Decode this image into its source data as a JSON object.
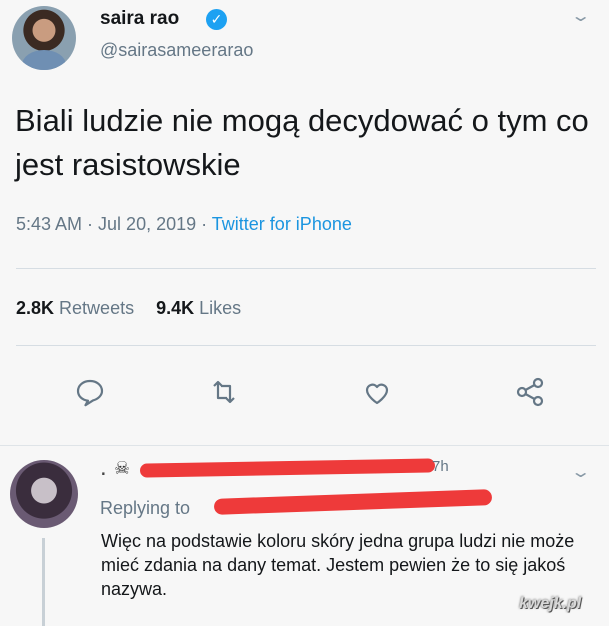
{
  "tweet": {
    "author_name": "saira rao",
    "handle": "@sairasameerarao",
    "text": "Biali ludzie nie mogą decydować o tym co jest rasistowskie",
    "time": "5:43 AM",
    "date": "Jul 20, 2019",
    "source": "Twitter for iPhone",
    "separator": " · ",
    "retweets_count": "2.8K",
    "retweets_label": "Retweets",
    "likes_count": "9.4K",
    "likes_label": "Likes",
    "verified_glyph": "✓",
    "chevron": "⌄",
    "icons": [
      "reply-icon",
      "retweet-icon",
      "like-icon",
      "share-icon"
    ]
  },
  "reply": {
    "time": "7h",
    "replying_label": "Replying to",
    "text": "Więc na podstawie koloru skóry jedna grupa ludzi nie może mieć zdania na dany temat. Jestem pewien że to się jakoś nazywa."
  },
  "watermark": "kwejk.pl",
  "colors": {
    "link": "#1b95e0",
    "verified": "#1da1f2",
    "secondary_text": "#657786",
    "redaction": "#ee3a3a"
  }
}
